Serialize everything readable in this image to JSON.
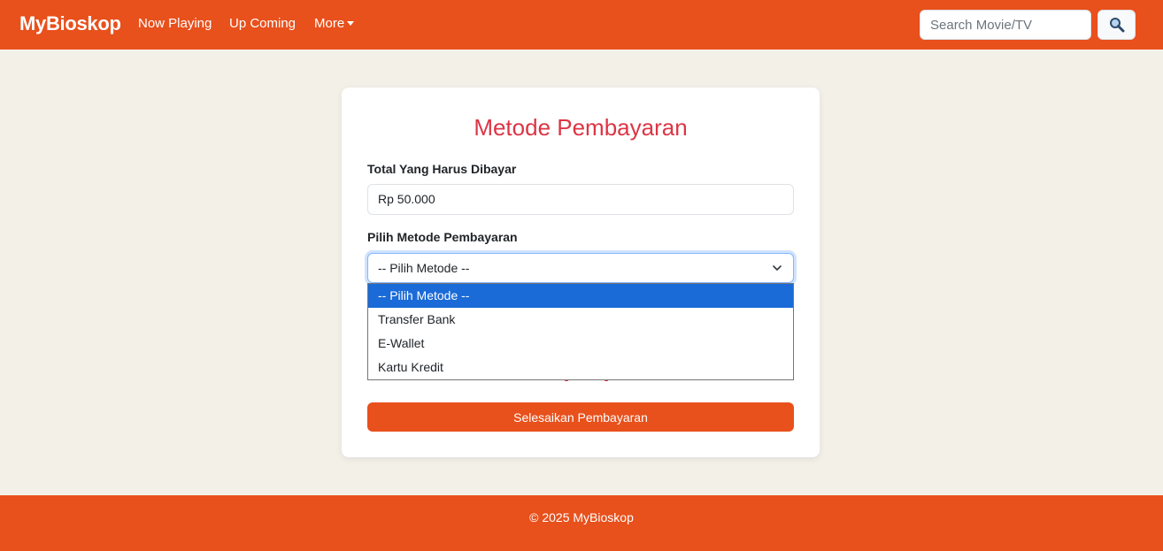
{
  "navbar": {
    "brand": "MyBioskop",
    "links": [
      "Now Playing",
      "Up Coming",
      "More"
    ],
    "search_placeholder": "Search Movie/TV",
    "search_icon": "magnifier-icon"
  },
  "card": {
    "title": "Metode Pembayaran",
    "total_label": "Total Yang Harus Dibayar",
    "total_value": "Rp 50.000",
    "method_label": "Pilih Metode Pembayaran",
    "method_selected": "-- Pilih Metode --",
    "method_options": [
      "-- Pilih Metode --",
      "Transfer Bank",
      "E-Wallet",
      "Kartu Kredit"
    ],
    "submit_label": "Selesaikan Pembayaran"
  },
  "footer": {
    "text": "© 2025 MyBioskop"
  },
  "colors": {
    "accent": "#e8501c",
    "title": "#dc3545",
    "page_bg": "#f3f0e8",
    "option_highlight": "#1a6ad8"
  }
}
